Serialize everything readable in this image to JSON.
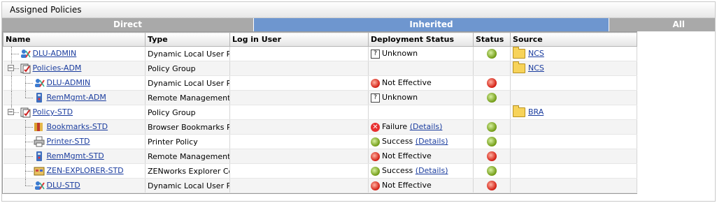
{
  "panel": {
    "title": "Assigned Policies"
  },
  "tabs": [
    {
      "label": "Direct",
      "active": false
    },
    {
      "label": "Inherited",
      "active": true
    },
    {
      "label": "All",
      "active": false
    }
  ],
  "columns": [
    "Name",
    "Type",
    "Log in User",
    "Deployment Status",
    "Status",
    "Source"
  ],
  "colors": {
    "active_tab": "#6e96cf",
    "inactive_tab": "#a9a9a9",
    "link": "#1a3c9e"
  },
  "rows": [
    {
      "name": "DLU-ADMIN",
      "icon": "dlu-policy-icon",
      "type": "Dynamic Local User Policy",
      "login_user": "",
      "deploy_icon": "unknown-icon",
      "deploy_text": "Unknown",
      "deploy_link": "",
      "status": "green",
      "source": "NCS"
    },
    {
      "name": "Policies-ADM",
      "icon": "policy-group-icon",
      "type": "Policy Group",
      "login_user": "",
      "deploy_icon": "",
      "deploy_text": "",
      "deploy_link": "",
      "status": "",
      "source": "NCS"
    },
    {
      "name": "DLU-ADMIN",
      "icon": "dlu-policy-icon",
      "type": "Dynamic Local User Policy",
      "login_user": "",
      "deploy_icon": "not-effective-icon",
      "deploy_text": "Not Effective",
      "deploy_link": "",
      "status": "red",
      "source": ""
    },
    {
      "name": "RemMgmt-ADM",
      "icon": "remote-management-icon",
      "type": "Remote Management Policy",
      "login_user": "",
      "deploy_icon": "unknown-icon",
      "deploy_text": "Unknown",
      "deploy_link": "",
      "status": "green",
      "source": ""
    },
    {
      "name": "Policy-STD",
      "icon": "policy-group-icon",
      "type": "Policy Group",
      "login_user": "",
      "deploy_icon": "",
      "deploy_text": "",
      "deploy_link": "",
      "status": "",
      "source": "BRA"
    },
    {
      "name": "Bookmarks-STD",
      "icon": "bookmarks-icon",
      "type": "Browser Bookmarks Policy",
      "login_user": "",
      "deploy_icon": "failure-icon",
      "deploy_text": "Failure",
      "deploy_link": "(Details)",
      "status": "green",
      "source": ""
    },
    {
      "name": "Printer-STD",
      "icon": "printer-icon",
      "type": "Printer Policy",
      "login_user": "",
      "deploy_icon": "success-icon",
      "deploy_text": "Success",
      "deploy_link": "(Details)",
      "status": "green",
      "source": ""
    },
    {
      "name": "RemMgmt-STD",
      "icon": "remote-management-icon",
      "type": "Remote Management Policy",
      "login_user": "",
      "deploy_icon": "not-effective-icon",
      "deploy_text": "Not Effective",
      "deploy_link": "",
      "status": "red",
      "source": ""
    },
    {
      "name": "ZEN-EXPLORER-STD",
      "icon": "zen-explorer-icon",
      "type": "ZENworks Explorer Configuration Policy",
      "login_user": "",
      "deploy_icon": "success-icon",
      "deploy_text": "Success",
      "deploy_link": "(Details)",
      "status": "green",
      "source": ""
    },
    {
      "name": "DLU-STD",
      "icon": "dlu-policy-icon",
      "type": "Dynamic Local User Policy",
      "login_user": "",
      "deploy_icon": "not-effective-icon",
      "deploy_text": "Not Effective",
      "deploy_link": "",
      "status": "red",
      "source": ""
    }
  ]
}
